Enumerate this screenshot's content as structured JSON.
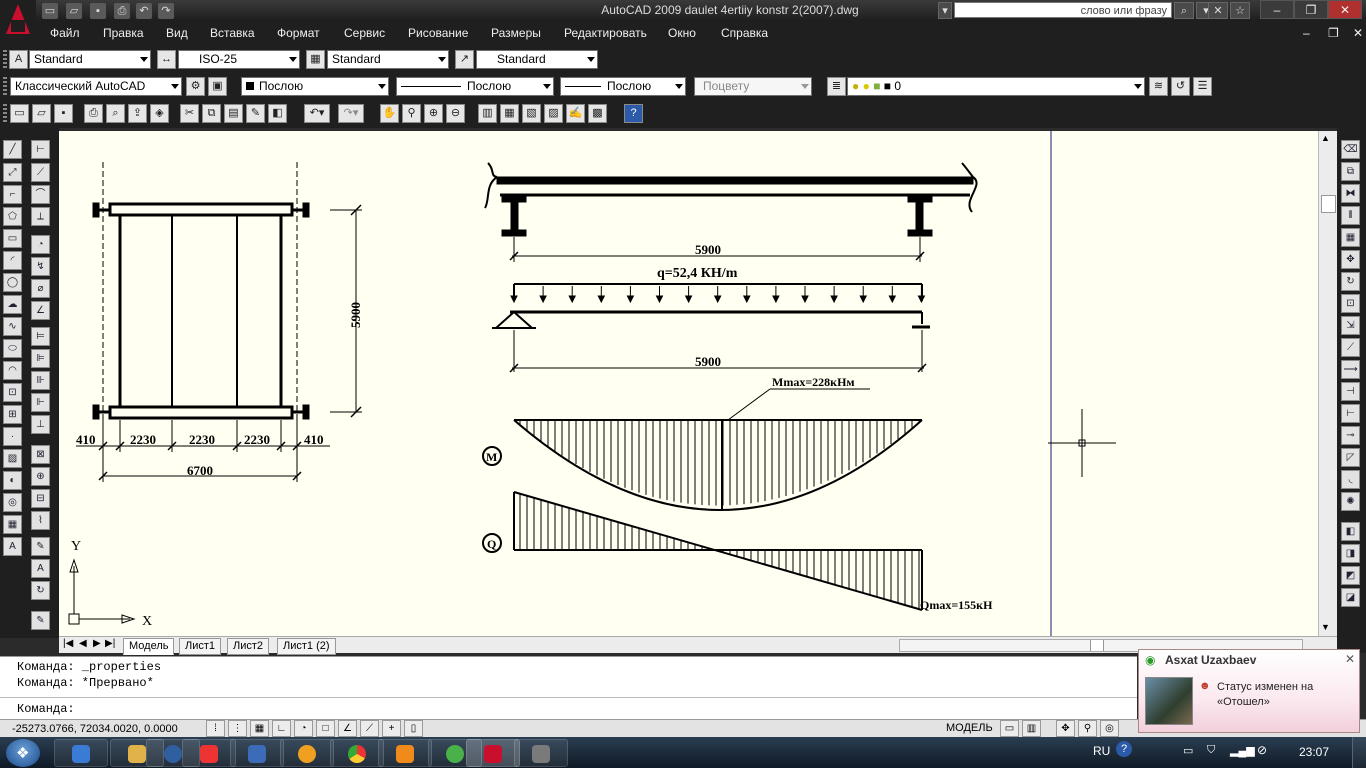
{
  "window": {
    "title": "AutoCAD 2009 daulet 4ertiiy konstr 2(2007).dwg",
    "search_placeholder": "слово или фразу",
    "app_icon": "autocad-logo"
  },
  "menu": [
    "Файл",
    "Правка",
    "Вид",
    "Вставка",
    "Формат",
    "Сервис",
    "Рисование",
    "Размеры",
    "Редактировать",
    "Окно",
    "Справка"
  ],
  "styles_toolbar": {
    "text_style": "Standard",
    "dim_style": "ISO-25",
    "table_style": "Standard",
    "mleader_style": "Standard"
  },
  "properties_toolbar": {
    "workspace": "Классический AutoCAD",
    "color": "Послою",
    "linetype": "Послою",
    "lineweight": "Послою",
    "plotstyle": "Поцвету",
    "layer": "0"
  },
  "drawing": {
    "plan_dims": {
      "side_left": "410",
      "span1": "2230",
      "span2": "2230",
      "span3": "2230",
      "side_right": "410",
      "total": "6700",
      "height": "5900"
    },
    "beam_span_top": "5900",
    "load_label": "q=52,4 КН/m",
    "load_span": "5900",
    "moment_max": "Mmax=228кНм",
    "moment_symbol": "M",
    "shear_symbol": "Q",
    "shear_max": "Qmax=155кН",
    "ucs": {
      "y": "Y",
      "x": "X"
    }
  },
  "layout_tabs": [
    "Модель",
    "Лист1",
    "Лист2",
    "Лист1 (2)"
  ],
  "command": {
    "history": [
      "Команда: _properties",
      "Команда: *Прервано*"
    ],
    "prompt": "Команда:"
  },
  "status": {
    "coords": "-25273.0766, 72034.0020, 0.0000",
    "space": "МОДЕЛЬ"
  },
  "notification": {
    "user": "Asxat Uzaxbaev",
    "message": "Статус изменен на «Отошел»"
  },
  "tray": {
    "lang": "RU",
    "time": "23:07"
  }
}
